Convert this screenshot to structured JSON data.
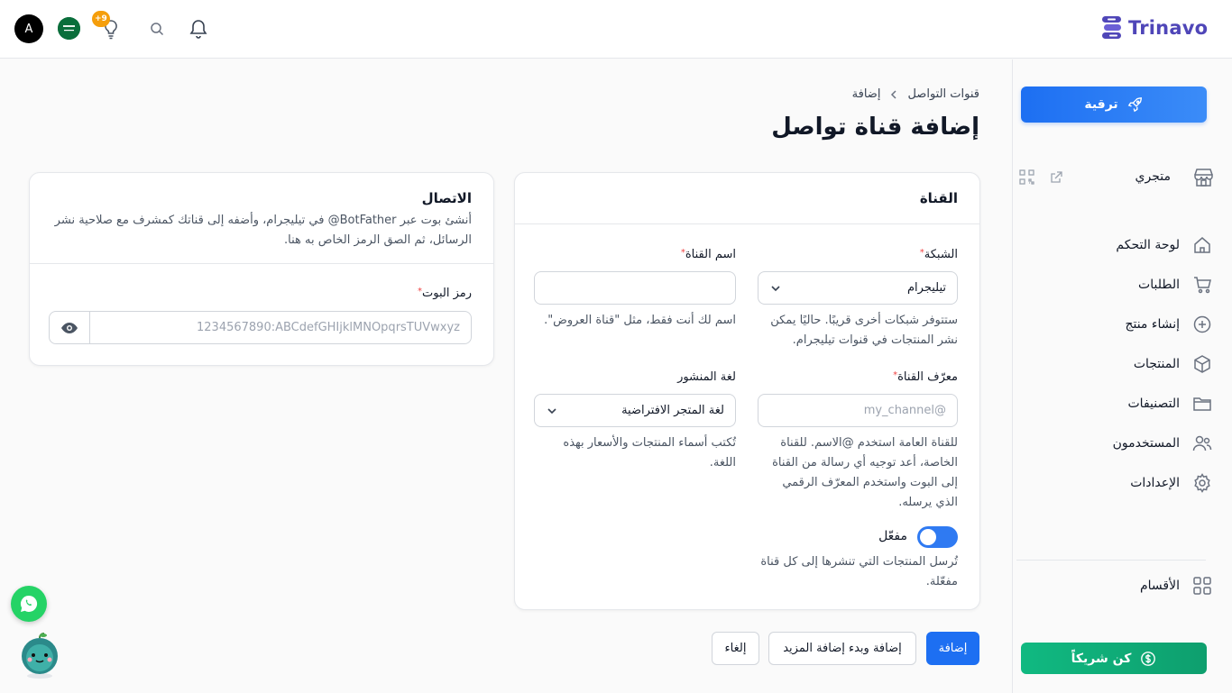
{
  "topbar": {
    "avatar_letter": "A",
    "notification_badge": "+9",
    "logo_text": "Trinavo"
  },
  "sidebar": {
    "upgrade_label": "ترقية",
    "store_label": "متجري",
    "items": [
      {
        "label": "لوحة التحكم",
        "icon": "home-icon"
      },
      {
        "label": "الطلبات",
        "icon": "cart-icon"
      },
      {
        "label": "إنشاء منتج",
        "icon": "plus-circle-icon"
      },
      {
        "label": "المنتجات",
        "icon": "box-icon"
      },
      {
        "label": "التصنيفات",
        "icon": "folder-icon"
      },
      {
        "label": "المستخدمون",
        "icon": "users-icon"
      },
      {
        "label": "الإعدادات",
        "icon": "gear-icon"
      }
    ],
    "sections_label": "الأقسام",
    "partner_label": "كن شريكاً"
  },
  "breadcrumb": {
    "parent": "قنوات التواصل",
    "current": "إضافة"
  },
  "page_title": "إضافة قناة تواصل",
  "channel_card": {
    "title": "القناة",
    "network_label": "الشبكة",
    "network_value": "تيليجرام",
    "network_hint": "ستتوفر شبكات أخرى قريبًا. حاليًا يمكن نشر المنتجات في قنوات تيليجرام.",
    "name_label": "اسم القناة",
    "name_value": "",
    "name_hint": "اسم لك أنت فقط، مثل \"قناة العروض\".",
    "id_label": "معرّف القناة",
    "id_placeholder": "my_channel@",
    "id_hint": "للقناة العامة استخدم @الاسم. للقناة الخاصة، أعد توجيه أي رسالة من القناة إلى البوت واستخدم المعرّف الرقمي الذي يرسله.",
    "language_label": "لغة المنشور",
    "language_value": "لغة المتجر الافتراضية",
    "language_hint": "تُكتب أسماء المنتجات والأسعار بهذه اللغة.",
    "enabled_label": "مفعّل",
    "enabled": true,
    "enabled_hint": "تُرسل المنتجات التي تنشرها إلى كل قناة مفعّلة."
  },
  "connection_card": {
    "title": "الاتصال",
    "description": "أنشئ بوت عبر BotFather@ في تيليجرام، وأضفه إلى قناتك كمشرف مع صلاحية نشر الرسائل، ثم الصق الرمز الخاص به هنا.",
    "token_label": "رمز البوت",
    "token_placeholder": "1234567890:ABCdefGHIjklMNOpqrsTUVwxyz"
  },
  "actions": {
    "add": "إضافة",
    "add_and_more": "إضافة وبدء إضافة المزيد",
    "cancel": "إلغاء"
  },
  "colors": {
    "primary": "#1d6ff2",
    "partner": "#10b981",
    "brand": "#4f46b8",
    "required": "#ef4444"
  }
}
